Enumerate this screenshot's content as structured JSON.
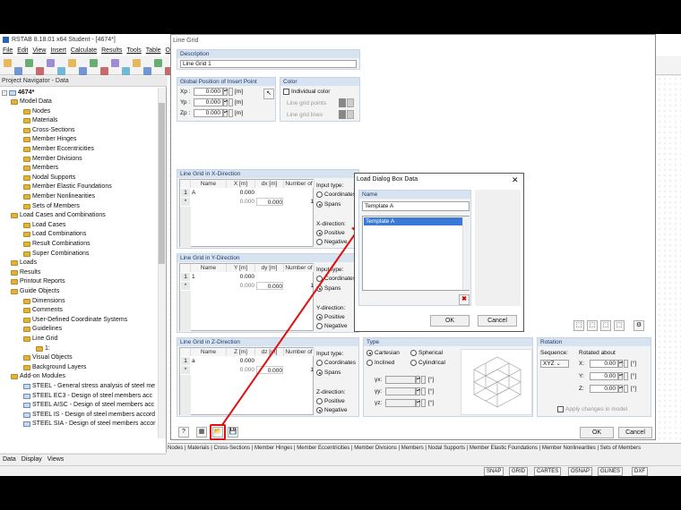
{
  "app": {
    "title": "RSTAB 8.18.01 x64 Student - [4674*]",
    "menu": [
      "File",
      "Edit",
      "View",
      "Insert",
      "Calculate",
      "Results",
      "Tools",
      "Table",
      "Options",
      "Add-on Modules",
      "Window",
      "Help"
    ]
  },
  "navigator": {
    "title": "Project Navigator - Data",
    "root": "4674*",
    "items": [
      "Model Data",
      "Nodes",
      "Materials",
      "Cross-Sections",
      "Member Hinges",
      "Member Eccentricities",
      "Member Divisions",
      "Members",
      "Nodal Supports",
      "Member Elastic Foundations",
      "Member Nonlinearities",
      "Sets of Members",
      "Load Cases and Combinations",
      "Load Cases",
      "Load Combinations",
      "Result Combinations",
      "Super Combinations",
      "Loads",
      "Results",
      "Printout Reports",
      "Guide Objects",
      "Dimensions",
      "Comments",
      "User-Defined Coordinate Systems",
      "Guidelines",
      "Line Grid",
      "1:",
      "Visual Objects",
      "Background Layers",
      "Add-on Modules",
      "STEEL - General stress analysis of steel me",
      "STEEL EC3 - Design of steel members acc",
      "STEEL AISC - Design of steel members acc",
      "STEEL IS - Design of steel members accord",
      "STEEL SIA - Design of steel members accor"
    ],
    "tabs": [
      "Data",
      "Display",
      "Views"
    ]
  },
  "bottom_tabs": "Nodes | Materials | Cross-Sections | Member Hinges | Member Eccentricities | Member Divisions | Members | Nodal Supports | Member Elastic Foundations | Member Nonlinearities | Sets of Members",
  "status": [
    "SNAP",
    "GRID",
    "CARTES",
    "OSNAP",
    "GLINES",
    "DXF"
  ],
  "line_grid": {
    "title": "Line Grid",
    "description_label": "Description",
    "description_value": "Line Grid 1",
    "insert_point_label": "Global Position of Insert Point",
    "xp": "0.000",
    "yp": "0.000",
    "zp": "0.000",
    "unit": "[m]",
    "xp_label": "Xp :",
    "yp_label": "Yp :",
    "zp_label": "Zp :",
    "color_label": "Color",
    "individual_color": "Individual color",
    "grid_points": "Line grid points",
    "grid_lines": "Line grid lines",
    "x_dir": {
      "title": "Line Grid in X-Direction",
      "headers": [
        "",
        "Name",
        "X [m]",
        "dx [m]",
        "Number of"
      ],
      "rows": [
        [
          "1",
          "A",
          "0.000",
          "",
          ""
        ],
        [
          "*",
          "",
          "0.000",
          "0.000",
          "1"
        ]
      ]
    },
    "y_dir": {
      "title": "Line Grid in Y-Direction",
      "headers": [
        "",
        "Name",
        "Y [m]",
        "dy [m]",
        "Number of"
      ],
      "rows": [
        [
          "1",
          "1",
          "0.000",
          "",
          ""
        ],
        [
          "*",
          "",
          "0.000",
          "0.000",
          "1"
        ]
      ]
    },
    "z_dir": {
      "title": "Line Grid in Z-Direction",
      "headers": [
        "",
        "Name",
        "Z [m]",
        "dz [m]",
        "Number of"
      ],
      "rows": [
        [
          "1",
          "a",
          "0.000",
          "",
          ""
        ],
        [
          "*",
          "",
          "0.000",
          "0.000",
          "1"
        ]
      ]
    },
    "input_type": "Input type:",
    "coordinates": "Coordinates",
    "spans": "Spans",
    "x_direction": "X-direction:",
    "y_direction": "Y-direction:",
    "z_direction": "Z-direction:",
    "positive": "Positive",
    "negative": "Negative",
    "type_label": "Type",
    "cartesian": "Cartesian",
    "spherical": "Spherical",
    "inclined": "Inclined",
    "cylindrical": "Cylindrical",
    "gamma_x": "γx:",
    "gamma_y": "γy:",
    "gamma_z": "γz:",
    "deg_unit": "[°]",
    "rotation_label": "Rotation",
    "sequence_label": "Sequence:",
    "sequence_value": "XYZ",
    "rotated_about": "Rotated about",
    "rx": "0.00",
    "ry": "0.00",
    "rz": "0.00",
    "rx_label": "X:",
    "ry_label": "Y:",
    "rz_label": "Z:",
    "apply_changes": "Apply changes in model",
    "ok": "OK",
    "cancel": "Cancel"
  },
  "load_dialog": {
    "title": "Load Dialog Box Data",
    "name_label": "Name",
    "name_value": "Template A",
    "list": [
      "Template A"
    ],
    "ok": "OK",
    "cancel": "Cancel"
  },
  "colors": {
    "accent_blue": "#2b63b8",
    "selection": "#3b79d6",
    "highlight_red": "#d11"
  }
}
